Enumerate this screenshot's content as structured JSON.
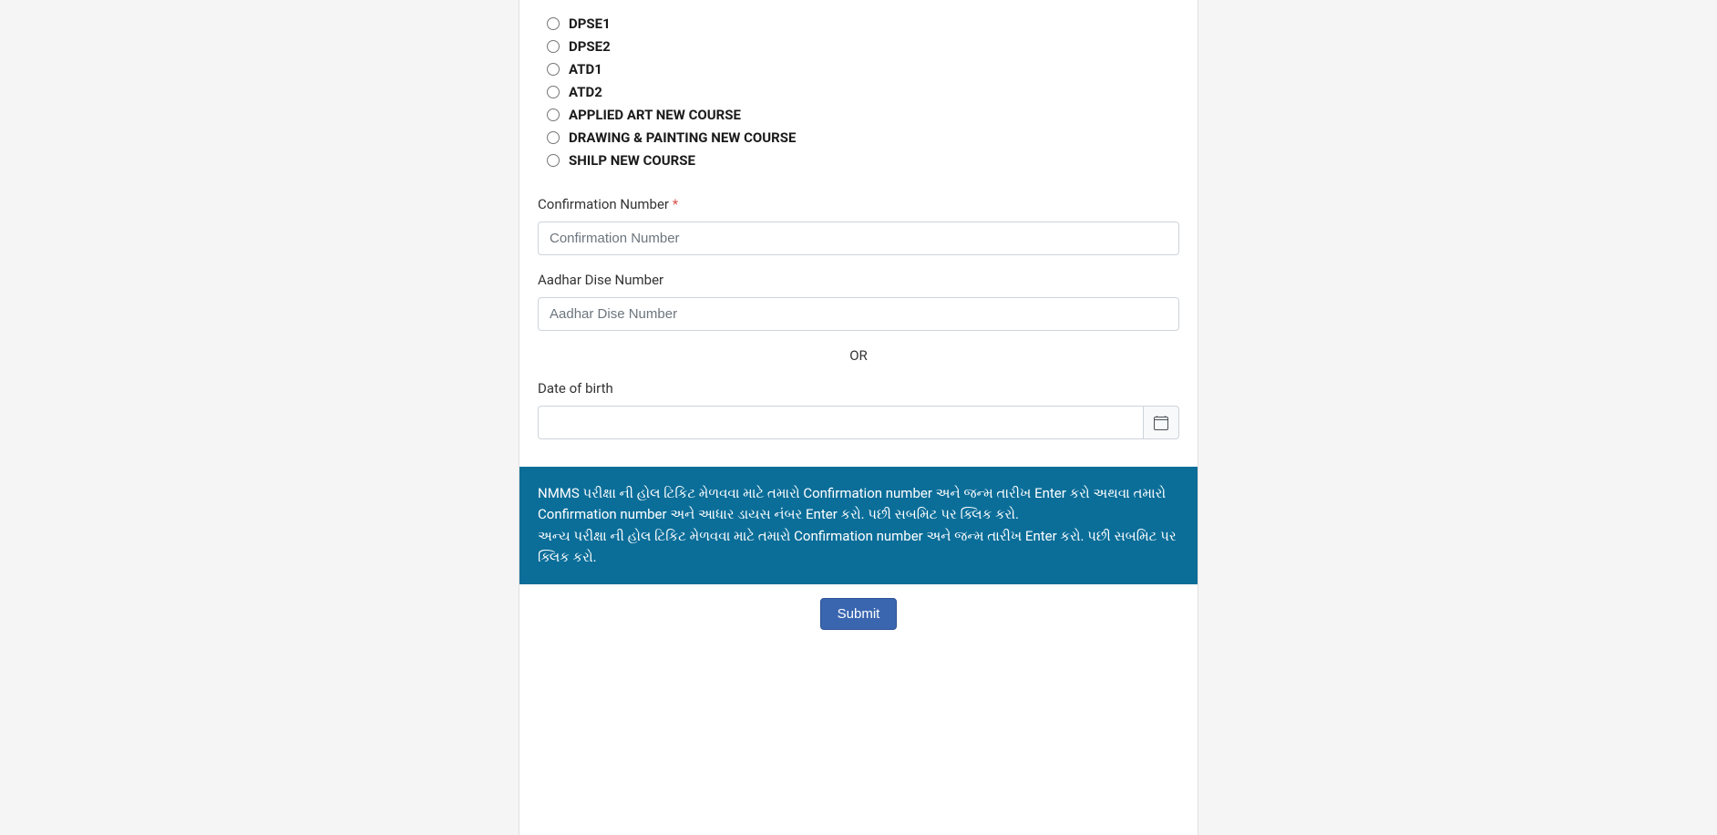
{
  "radio_options": [
    {
      "id": "dpse1",
      "label": "DPSE1"
    },
    {
      "id": "dpse2",
      "label": "DPSE2"
    },
    {
      "id": "atd1",
      "label": "ATD1"
    },
    {
      "id": "atd2",
      "label": "ATD2"
    },
    {
      "id": "applied-art",
      "label": "APPLIED ART NEW COURSE"
    },
    {
      "id": "drawing-painting",
      "label": "DRAWING & PAINTING NEW COURSE"
    },
    {
      "id": "shilp",
      "label": "SHILP NEW COURSE"
    }
  ],
  "fields": {
    "confirmation": {
      "label": "Confirmation Number",
      "required_mark": "*",
      "placeholder": "Confirmation Number"
    },
    "aadhar": {
      "label": "Aadhar Dise Number",
      "placeholder": "Aadhar Dise Number"
    },
    "or_text": "OR",
    "dob": {
      "label": "Date of birth"
    }
  },
  "info_text": "NMMS પરીક્ષા ની હોલ ટિકિટ મેળવવા માટે તમારો Confirmation number અને જન્મ તારીખ Enter કરો અથવા તમારો Confirmation number અને આધાર ડાયસ નંબર Enter કરો. પછી સબમિટ પર ક્લિક કરો.\nઅન્ય પરીક્ષા ની હોલ ટિકિટ મેળવવા માટે તમારો Confirmation number અને જન્મ તારીખ Enter કરો. પછી સબમિટ પર ક્લિક કરો.",
  "submit_label": "Submit"
}
